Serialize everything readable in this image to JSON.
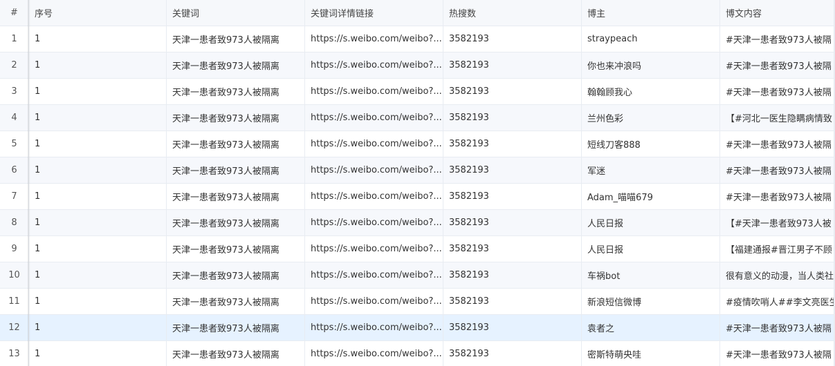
{
  "columns": [
    "#",
    "序号",
    "关键词",
    "关键词详情链接",
    "热搜数",
    "博主",
    "博文内容"
  ],
  "rows": [
    [
      "1",
      "1",
      "天津一患者致973人被隔离",
      "https://s.weibo.com/weibo?...",
      "3582193",
      "straypeach",
      "#天津一患者致973人被隔"
    ],
    [
      "2",
      "1",
      "天津一患者致973人被隔离",
      "https://s.weibo.com/weibo?...",
      "3582193",
      "你也来冲浪吗",
      "#天津一患者致973人被隔"
    ],
    [
      "3",
      "1",
      "天津一患者致973人被隔离",
      "https://s.weibo.com/weibo?...",
      "3582193",
      "翰翰顾我心",
      "#天津一患者致973人被隔"
    ],
    [
      "4",
      "1",
      "天津一患者致973人被隔离",
      "https://s.weibo.com/weibo?...",
      "3582193",
      "兰州色彩",
      "【#河北一医生隐瞒病情致"
    ],
    [
      "5",
      "1",
      "天津一患者致973人被隔离",
      "https://s.weibo.com/weibo?...",
      "3582193",
      "短线刀客888",
      "#天津一患者致973人被隔"
    ],
    [
      "6",
      "1",
      "天津一患者致973人被隔离",
      "https://s.weibo.com/weibo?...",
      "3582193",
      "军迷",
      "#天津一患者致973人被隔"
    ],
    [
      "7",
      "1",
      "天津一患者致973人被隔离",
      "https://s.weibo.com/weibo?...",
      "3582193",
      "Adam_喵喵679",
      "#天津一患者致973人被隔"
    ],
    [
      "8",
      "1",
      "天津一患者致973人被隔离",
      "https://s.weibo.com/weibo?...",
      "3582193",
      "人民日报",
      "【#天津一患者致973人被"
    ],
    [
      "9",
      "1",
      "天津一患者致973人被隔离",
      "https://s.weibo.com/weibo?...",
      "3582193",
      "人民日报",
      "【福建通报#晋江男子不顾"
    ],
    [
      "10",
      "1",
      "天津一患者致973人被隔离",
      "https://s.weibo.com/weibo?...",
      "3582193",
      "车祸bot",
      "很有意义的动漫，当人类社"
    ],
    [
      "11",
      "1",
      "天津一患者致973人被隔离",
      "https://s.weibo.com/weibo?...",
      "3582193",
      "新浪短信微博",
      "#疫情吹哨人##李文亮医生"
    ],
    [
      "12",
      "1",
      "天津一患者致973人被隔离",
      "https://s.weibo.com/weibo?...",
      "3582193",
      "袁者之",
      "#天津一患者致973人被隔"
    ],
    [
      "13",
      "1",
      "天津一患者致973人被隔离",
      "https://s.weibo.com/weibo?...",
      "3582193",
      "密斯特萌央哇",
      "#天津一患者致973人被隔"
    ]
  ],
  "selected_row": 12
}
